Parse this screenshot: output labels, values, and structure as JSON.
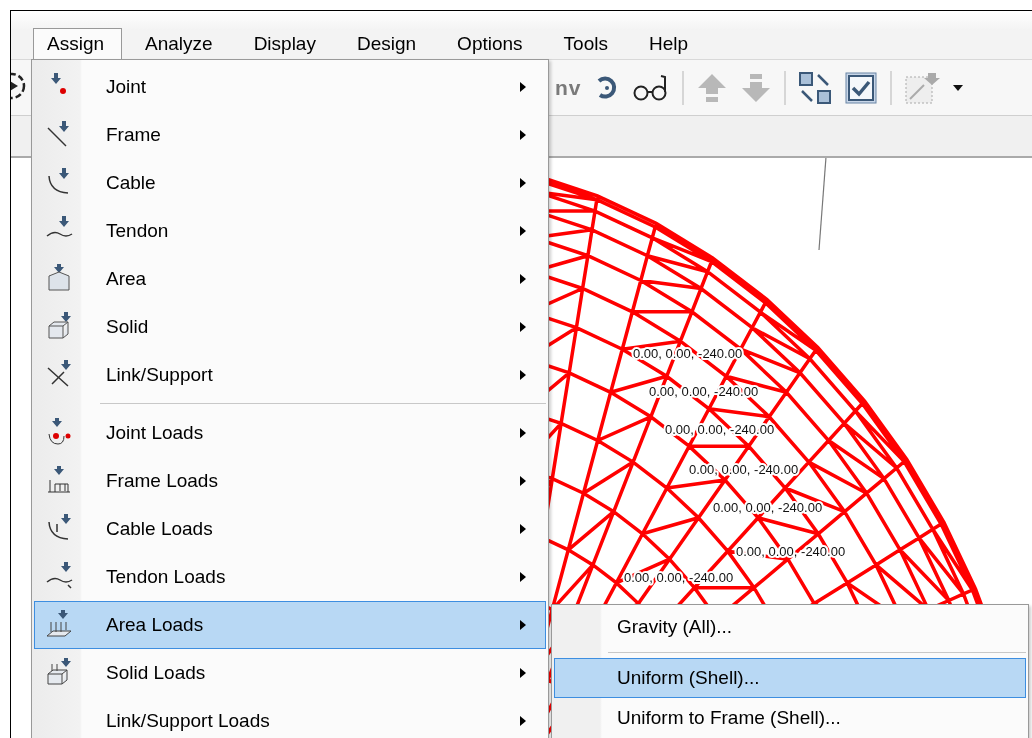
{
  "menu_bar": [
    {
      "label": "Assign",
      "selected": true
    },
    {
      "label": "Analyze",
      "selected": false
    },
    {
      "label": "Display",
      "selected": false
    },
    {
      "label": "Design",
      "selected": false
    },
    {
      "label": "Options",
      "selected": false
    },
    {
      "label": "Tools",
      "selected": false
    },
    {
      "label": "Help",
      "selected": false
    }
  ],
  "toolbar": {
    "text": "nv"
  },
  "assign_menu": [
    {
      "kind": "item",
      "label": "Joint",
      "submenu": true,
      "selected": false
    },
    {
      "kind": "item",
      "label": "Frame",
      "submenu": true,
      "selected": false
    },
    {
      "kind": "item",
      "label": "Cable",
      "submenu": true,
      "selected": false
    },
    {
      "kind": "item",
      "label": "Tendon",
      "submenu": true,
      "selected": false
    },
    {
      "kind": "item",
      "label": "Area",
      "submenu": true,
      "selected": false
    },
    {
      "kind": "item",
      "label": "Solid",
      "submenu": true,
      "selected": false
    },
    {
      "kind": "item",
      "label": "Link/Support",
      "submenu": true,
      "selected": false
    },
    {
      "kind": "separator"
    },
    {
      "kind": "item",
      "label": "Joint Loads",
      "submenu": true,
      "selected": false
    },
    {
      "kind": "item",
      "label": "Frame Loads",
      "submenu": true,
      "selected": false
    },
    {
      "kind": "item",
      "label": "Cable Loads",
      "submenu": true,
      "selected": false
    },
    {
      "kind": "item",
      "label": "Tendon Loads",
      "submenu": true,
      "selected": false
    },
    {
      "kind": "item",
      "label": "Area Loads",
      "submenu": true,
      "selected": true
    },
    {
      "kind": "item",
      "label": "Solid Loads",
      "submenu": true,
      "selected": false
    },
    {
      "kind": "item",
      "label": "Link/Support Loads",
      "submenu": true,
      "selected": false
    }
  ],
  "area_loads_submenu": [
    {
      "kind": "item",
      "label": "Gravity (All)...",
      "selected": false
    },
    {
      "kind": "separator"
    },
    {
      "kind": "item",
      "label": "Uniform (Shell)...",
      "selected": true
    },
    {
      "kind": "item",
      "label": "Uniform to Frame (Shell)...",
      "selected": false
    }
  ],
  "canvas": {
    "load_labels": [
      "0.00, 0.00, -240.00",
      "0.00, 0.00, -240.00",
      "0.00, 0.00, -240.00",
      "0.00, 0.00, -240.00",
      "0.00, 0.00, -240.00",
      "0.00, 0.00, -240.00",
      "0.00, 0.00, -240.00"
    ]
  }
}
